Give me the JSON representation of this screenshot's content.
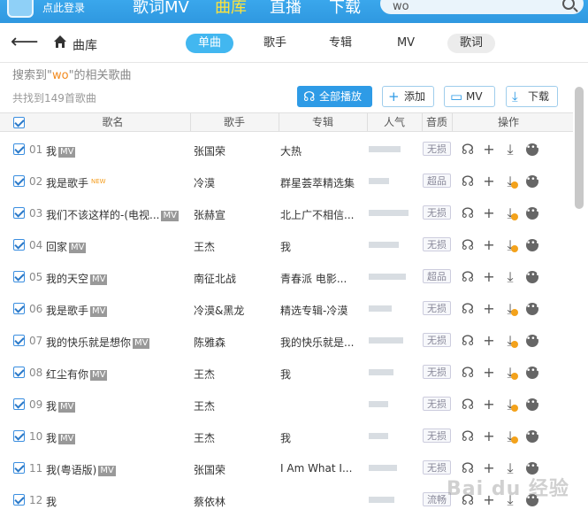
{
  "topbar": {
    "login": "点此登录",
    "nav": [
      "歌词MV",
      "曲库",
      "直播",
      "下载"
    ],
    "search_value": "wo"
  },
  "nav": {
    "crumb": "曲库",
    "tabs": [
      "单曲",
      "歌手",
      "专辑",
      "MV",
      "歌词"
    ]
  },
  "result": {
    "prefix": "搜索到\"",
    "keyword": "wo",
    "suffix": "\"的相关歌曲",
    "count": "共找到149首歌曲"
  },
  "buttons": {
    "play_all": "全部播放",
    "add": "添加",
    "mv": "MV",
    "download": "下载"
  },
  "columns": [
    "歌名",
    "歌手",
    "专辑",
    "人气",
    "音质",
    "操作"
  ],
  "rows": [
    {
      "num": "01",
      "title": "我",
      "mv": "MV",
      "new": "",
      "singer": "张国荣",
      "album": "大热",
      "quality": "无损",
      "pop": 0.62,
      "coin": false
    },
    {
      "num": "02",
      "title": "我是歌手",
      "mv": "",
      "new": "NEW",
      "singer": "冷漠",
      "album": "群星荟萃精选集",
      "quality": "超品",
      "pop": 0.4,
      "coin": true
    },
    {
      "num": "03",
      "title": "我们不该这样的-(电视...",
      "mv": "MV",
      "new": "",
      "singer": "张赫宣",
      "album": "北上广不相信...",
      "quality": "无损",
      "pop": 0.78,
      "coin": true
    },
    {
      "num": "04",
      "title": "回家",
      "mv": "MV",
      "new": "",
      "singer": "王杰",
      "album": "我",
      "quality": "无损",
      "pop": 0.58,
      "coin": true
    },
    {
      "num": "05",
      "title": "我的天空",
      "mv": "MV",
      "new": "",
      "singer": "南征北战",
      "album": "青春派 电影...",
      "quality": "超品",
      "pop": 0.72,
      "coin": false
    },
    {
      "num": "06",
      "title": "我是歌手",
      "mv": "MV",
      "new": "",
      "singer": "冷漠&黑龙",
      "album": "精选专辑-冷漠",
      "quality": "无损",
      "pop": 0.45,
      "coin": true
    },
    {
      "num": "07",
      "title": "我的快乐就是想你",
      "mv": "MV",
      "new": "",
      "singer": "陈雅森",
      "album": "我的快乐就是...",
      "quality": "无损",
      "pop": 0.68,
      "coin": true
    },
    {
      "num": "08",
      "title": "红尘有你",
      "mv": "MV",
      "new": "",
      "singer": "王杰",
      "album": "我",
      "quality": "无损",
      "pop": 0.48,
      "coin": true
    },
    {
      "num": "09",
      "title": "我",
      "mv": "MV",
      "new": "",
      "singer": "王杰",
      "album": "",
      "quality": "无损",
      "pop": 0.38,
      "coin": true
    },
    {
      "num": "10",
      "title": "我",
      "mv": "MV",
      "new": "",
      "singer": "王杰",
      "album": "我",
      "quality": "无损",
      "pop": 0.38,
      "coin": true
    },
    {
      "num": "11",
      "title": "我(粤语版)",
      "mv": "MV",
      "new": "",
      "singer": "张国荣",
      "album": "I Am What I...",
      "quality": "无损",
      "pop": 0.55,
      "coin": false
    },
    {
      "num": "12",
      "title": "我",
      "mv": "",
      "new": "",
      "singer": "蔡依林",
      "album": "",
      "quality": "流畅",
      "pop": 0.5,
      "coin": false
    }
  ],
  "watermark": "Bai du 经验"
}
